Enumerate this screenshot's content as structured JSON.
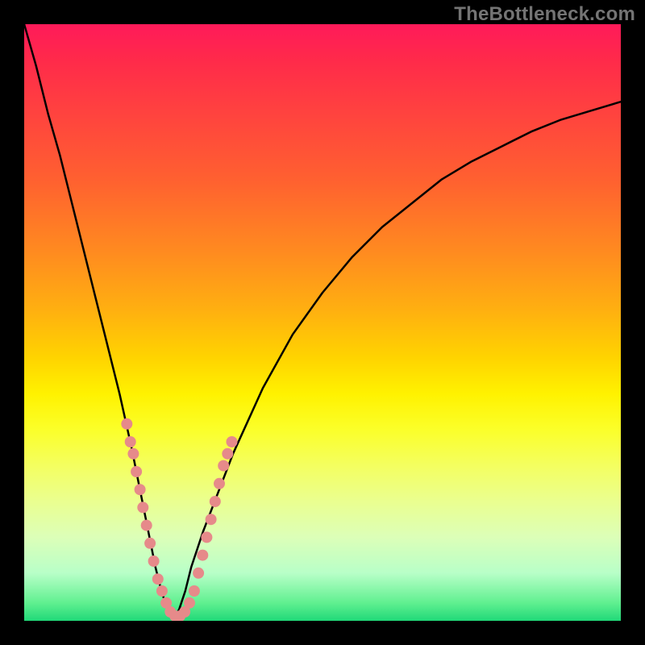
{
  "watermark": {
    "text": "TheBottleneck.com"
  },
  "chart_data": {
    "type": "line",
    "title": "",
    "xlabel": "",
    "ylabel": "",
    "xlim": [
      0,
      100
    ],
    "ylim": [
      0,
      100
    ],
    "grid": false,
    "legend": false,
    "series": [
      {
        "name": "bottleneck-curve",
        "x": [
          0,
          2,
          4,
          6,
          8,
          10,
          12,
          14,
          16,
          18,
          20,
          21,
          22,
          23,
          24,
          25,
          26,
          27,
          28,
          30,
          35,
          40,
          45,
          50,
          55,
          60,
          65,
          70,
          75,
          80,
          85,
          90,
          95,
          100
        ],
        "y": [
          100,
          93,
          85,
          78,
          70,
          62,
          54,
          46,
          38,
          29,
          19,
          14,
          9,
          5,
          2,
          0,
          2,
          5,
          9,
          15,
          28,
          39,
          48,
          55,
          61,
          66,
          70,
          74,
          77,
          79.5,
          82,
          84,
          85.5,
          87
        ]
      }
    ],
    "markers": {
      "name": "highlight-dots",
      "color": "#e68a8a",
      "radius_px": 7,
      "points_xy": [
        [
          17.2,
          33
        ],
        [
          17.8,
          30
        ],
        [
          18.3,
          28
        ],
        [
          18.8,
          25
        ],
        [
          19.4,
          22
        ],
        [
          19.9,
          19
        ],
        [
          20.5,
          16
        ],
        [
          21.1,
          13
        ],
        [
          21.7,
          10
        ],
        [
          22.4,
          7
        ],
        [
          23.1,
          5
        ],
        [
          23.8,
          3
        ],
        [
          24.5,
          1.5
        ],
        [
          25.3,
          0.8
        ],
        [
          26.1,
          0.8
        ],
        [
          26.9,
          1.5
        ],
        [
          27.7,
          3
        ],
        [
          28.5,
          5
        ],
        [
          29.2,
          8
        ],
        [
          29.9,
          11
        ],
        [
          30.6,
          14
        ],
        [
          31.3,
          17
        ],
        [
          32.0,
          20
        ],
        [
          32.7,
          23
        ],
        [
          33.4,
          26
        ],
        [
          34.1,
          28
        ],
        [
          34.8,
          30
        ]
      ]
    },
    "background": {
      "type": "vertical-gradient",
      "stops": [
        {
          "pct": 0,
          "color": "#ff1a5a"
        },
        {
          "pct": 25,
          "color": "#ff7028"
        },
        {
          "pct": 50,
          "color": "#ffd400"
        },
        {
          "pct": 75,
          "color": "#f0ff80"
        },
        {
          "pct": 100,
          "color": "#20d878"
        }
      ]
    }
  }
}
